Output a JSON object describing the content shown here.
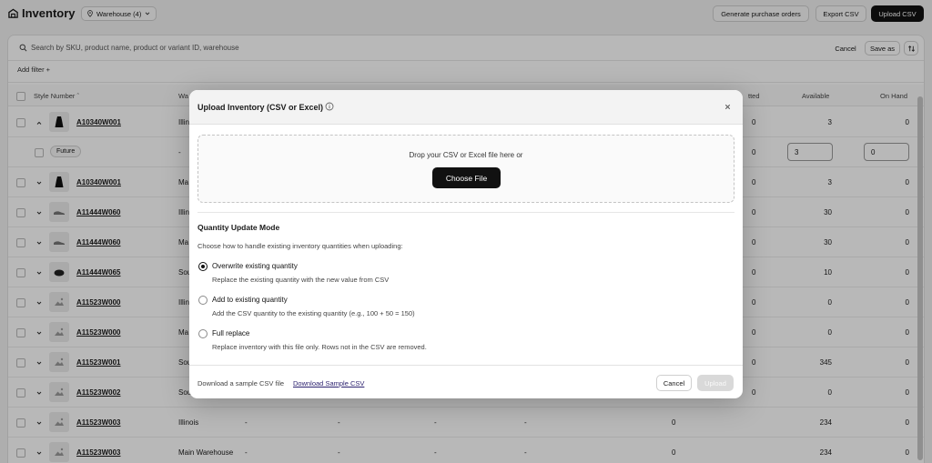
{
  "header": {
    "title": "Inventory",
    "warehouse_select": "Warehouse (4)",
    "generate_po": "Generate purchase orders",
    "export_csv": "Export CSV",
    "upload_csv": "Upload CSV"
  },
  "search": {
    "placeholder": "Search by SKU, product name, product or variant ID, warehouse",
    "cancel": "Cancel",
    "save_as": "Save as"
  },
  "filters": {
    "add_filter": "Add filter +"
  },
  "table": {
    "headers": {
      "style_number": "Style Number",
      "warehouse": "Wa",
      "committed": "tted",
      "available": "Available",
      "on_hand": "On Hand"
    },
    "rows": [
      {
        "sku": "A10340W001",
        "warehouse": "Illin",
        "committed": "0",
        "available": "3",
        "on_hand": "0"
      },
      {
        "badge": "Future",
        "warehouse": "-",
        "committed": "0",
        "available": "3",
        "on_hand": "0"
      },
      {
        "sku": "A10340W001",
        "warehouse": "Ma",
        "committed": "0",
        "available": "3",
        "on_hand": "0"
      },
      {
        "sku": "A11444W060",
        "warehouse": "Illin",
        "committed": "0",
        "available": "30",
        "on_hand": "0"
      },
      {
        "sku": "A11444W060",
        "warehouse": "Ma",
        "committed": "0",
        "available": "30",
        "on_hand": "0"
      },
      {
        "sku": "A11444W065",
        "warehouse": "Sou",
        "committed": "0",
        "available": "10",
        "on_hand": "0"
      },
      {
        "sku": "A11523W000",
        "warehouse": "Illin",
        "committed": "0",
        "available": "0",
        "on_hand": "0"
      },
      {
        "sku": "A11523W000",
        "warehouse": "Ma",
        "committed": "0",
        "available": "0",
        "on_hand": "0"
      },
      {
        "sku": "A11523W001",
        "warehouse": "Sou",
        "committed": "0",
        "available": "345",
        "on_hand": "0"
      },
      {
        "sku": "A11523W002",
        "warehouse": "Sou",
        "committed": "0",
        "available": "0",
        "on_hand": "0"
      },
      {
        "sku": "A11523W003",
        "warehouse": "Illinois",
        "committed": "0",
        "available": "234",
        "on_hand": "0",
        "dashes": [
          "-",
          "-",
          "-",
          "-"
        ]
      },
      {
        "sku": "A11523W003",
        "warehouse": "Main Warehouse",
        "committed": "0",
        "available": "234",
        "on_hand": "0",
        "dashes": [
          "-",
          "-",
          "-",
          "-"
        ]
      }
    ]
  },
  "modal": {
    "title": "Upload Inventory (CSV or Excel)",
    "drop_text": "Drop your CSV or Excel file here or",
    "choose_file": "Choose File",
    "section_title": "Quantity Update Mode",
    "section_sub": "Choose how to handle existing inventory quantities when uploading:",
    "options": [
      {
        "label": "Overwrite existing quantity",
        "desc": "Replace the existing quantity with the new value from CSV",
        "selected": true
      },
      {
        "label": "Add to existing quantity",
        "desc": "Add the CSV quantity to the existing quantity (e.g., 100 + 50 = 150)",
        "selected": false
      },
      {
        "label": "Full replace",
        "desc": "Replace inventory with this file only. Rows not in the CSV are removed.",
        "selected": false
      }
    ],
    "footer_text": "Download a sample CSV file",
    "footer_link": "Download Sample CSV",
    "cancel": "Cancel",
    "upload": "Upload"
  }
}
